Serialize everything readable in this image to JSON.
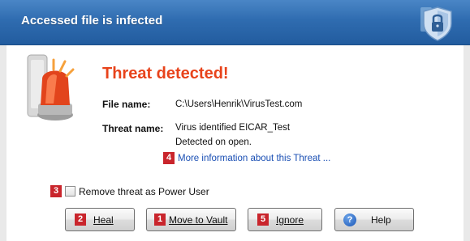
{
  "window": {
    "title": "Accessed file is infected"
  },
  "alert": {
    "headline": "Threat detected!",
    "file_label": "File name:",
    "file_value": "C:\\Users\\Henrik\\VirusTest.com",
    "threat_label": "Threat name:",
    "threat_value": "Virus identified EICAR_Test",
    "detected_text": "Detected on open.",
    "info_link": "More information about this Threat ...",
    "info_badge": "4"
  },
  "options": {
    "power_user_label": "Remove threat as Power User",
    "power_user_badge": "3",
    "power_user_checked": false
  },
  "buttons": {
    "heal": {
      "badge": "2",
      "label": "Heal"
    },
    "move": {
      "badge": "1",
      "label": "Move to Vault"
    },
    "ignore": {
      "badge": "5",
      "label": "Ignore"
    },
    "help": {
      "label": "Help"
    }
  },
  "colors": {
    "title_bar": "#2f6cb0",
    "headline": "#e8431b",
    "badge": "#c9252c",
    "link": "#1a4fb4"
  },
  "icons": {
    "title": "shield-lock-icon",
    "alert": "alarm-light-icon",
    "help": "help-icon"
  }
}
